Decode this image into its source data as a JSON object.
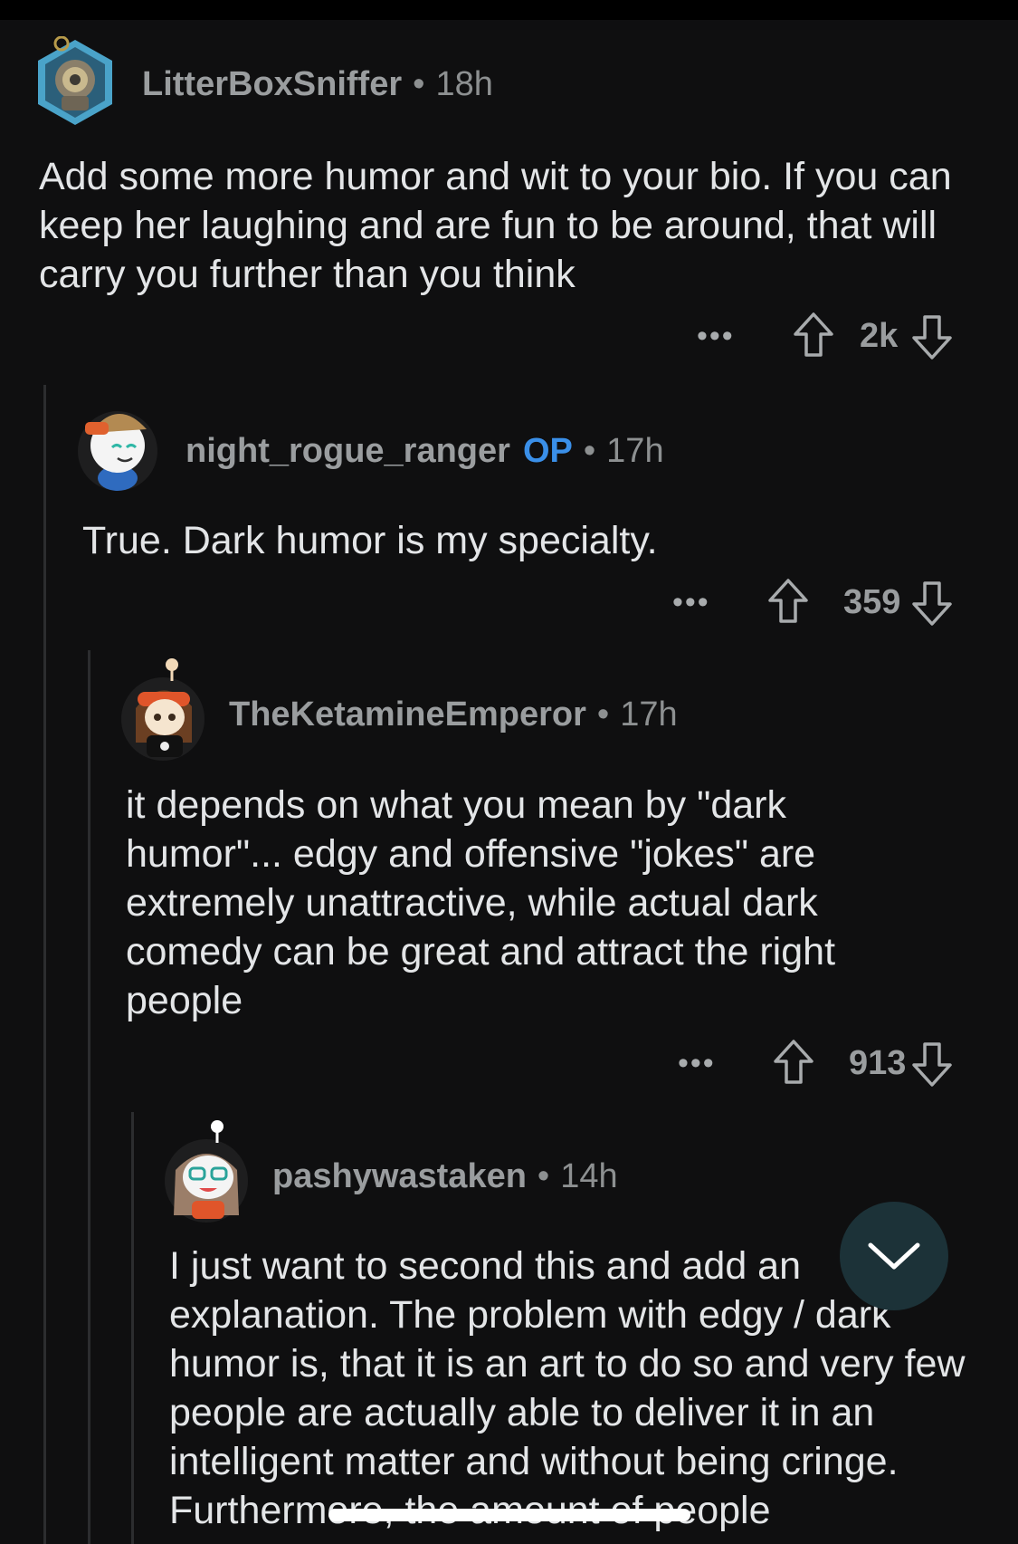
{
  "comments": [
    {
      "username": "LitterBoxSniffer",
      "time": "18h",
      "body": "Add some more humor and wit to your bio. If you can keep her laughing and are fun to be around, that will carry you further than you think",
      "score": "2k"
    },
    {
      "username": "night_rogue_ranger",
      "op_badge": "OP",
      "time": "17h",
      "body": "True. Dark humor is my specialty.",
      "score": "359"
    },
    {
      "username": "TheKetamineEmperor",
      "time": "17h",
      "body": "it depends on what you mean by \"dark humor\"... edgy and offensive \"jokes\" are extremely unattractive, while actual dark comedy can be great and attract the right people",
      "score": "913"
    },
    {
      "username": "pashywastaken",
      "time": "14h",
      "body": "I just want to second this and add an explanation. The problem with edgy / dark humor is, that it is an art to do so and very few people are actually able to deliver it in an intelligent matter and without being cringe. Furthermore, the amount of people"
    }
  ],
  "ui": {
    "separator": "•",
    "more_label": "•••",
    "accent_op_color": "#3a8fe8",
    "background_color": "#0f0f10",
    "fab_icon": "chevron-down-icon"
  }
}
